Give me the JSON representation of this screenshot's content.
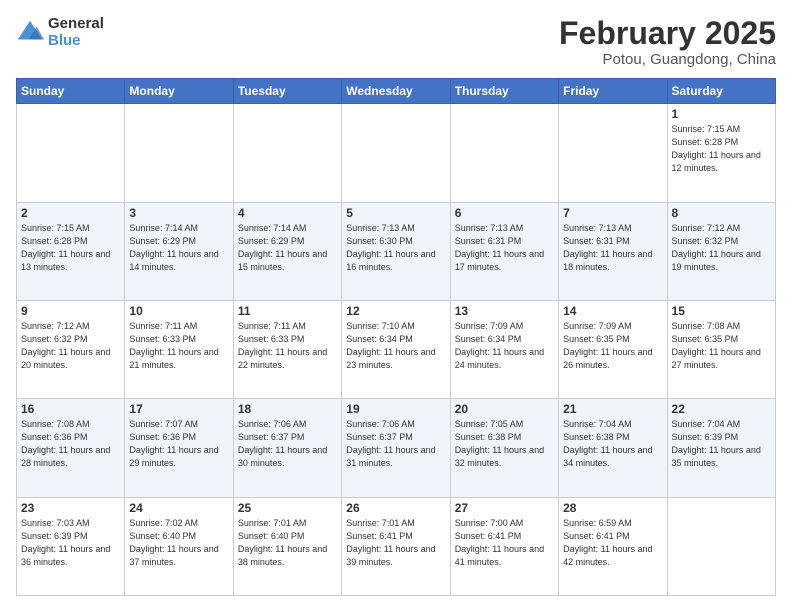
{
  "logo": {
    "line1": "General",
    "line2": "Blue"
  },
  "title": "February 2025",
  "subtitle": "Potou, Guangdong, China",
  "days_header": [
    "Sunday",
    "Monday",
    "Tuesday",
    "Wednesday",
    "Thursday",
    "Friday",
    "Saturday"
  ],
  "weeks": [
    [
      {
        "day": "",
        "info": ""
      },
      {
        "day": "",
        "info": ""
      },
      {
        "day": "",
        "info": ""
      },
      {
        "day": "",
        "info": ""
      },
      {
        "day": "",
        "info": ""
      },
      {
        "day": "",
        "info": ""
      },
      {
        "day": "1",
        "info": "Sunrise: 7:15 AM\nSunset: 6:28 PM\nDaylight: 11 hours and 12 minutes."
      }
    ],
    [
      {
        "day": "2",
        "info": "Sunrise: 7:15 AM\nSunset: 6:28 PM\nDaylight: 11 hours and 13 minutes."
      },
      {
        "day": "3",
        "info": "Sunrise: 7:14 AM\nSunset: 6:29 PM\nDaylight: 11 hours and 14 minutes."
      },
      {
        "day": "4",
        "info": "Sunrise: 7:14 AM\nSunset: 6:29 PM\nDaylight: 11 hours and 15 minutes."
      },
      {
        "day": "5",
        "info": "Sunrise: 7:13 AM\nSunset: 6:30 PM\nDaylight: 11 hours and 16 minutes."
      },
      {
        "day": "6",
        "info": "Sunrise: 7:13 AM\nSunset: 6:31 PM\nDaylight: 11 hours and 17 minutes."
      },
      {
        "day": "7",
        "info": "Sunrise: 7:13 AM\nSunset: 6:31 PM\nDaylight: 11 hours and 18 minutes."
      },
      {
        "day": "8",
        "info": "Sunrise: 7:12 AM\nSunset: 6:32 PM\nDaylight: 11 hours and 19 minutes."
      }
    ],
    [
      {
        "day": "9",
        "info": "Sunrise: 7:12 AM\nSunset: 6:32 PM\nDaylight: 11 hours and 20 minutes."
      },
      {
        "day": "10",
        "info": "Sunrise: 7:11 AM\nSunset: 6:33 PM\nDaylight: 11 hours and 21 minutes."
      },
      {
        "day": "11",
        "info": "Sunrise: 7:11 AM\nSunset: 6:33 PM\nDaylight: 11 hours and 22 minutes."
      },
      {
        "day": "12",
        "info": "Sunrise: 7:10 AM\nSunset: 6:34 PM\nDaylight: 11 hours and 23 minutes."
      },
      {
        "day": "13",
        "info": "Sunrise: 7:09 AM\nSunset: 6:34 PM\nDaylight: 11 hours and 24 minutes."
      },
      {
        "day": "14",
        "info": "Sunrise: 7:09 AM\nSunset: 6:35 PM\nDaylight: 11 hours and 26 minutes."
      },
      {
        "day": "15",
        "info": "Sunrise: 7:08 AM\nSunset: 6:35 PM\nDaylight: 11 hours and 27 minutes."
      }
    ],
    [
      {
        "day": "16",
        "info": "Sunrise: 7:08 AM\nSunset: 6:36 PM\nDaylight: 11 hours and 28 minutes."
      },
      {
        "day": "17",
        "info": "Sunrise: 7:07 AM\nSunset: 6:36 PM\nDaylight: 11 hours and 29 minutes."
      },
      {
        "day": "18",
        "info": "Sunrise: 7:06 AM\nSunset: 6:37 PM\nDaylight: 11 hours and 30 minutes."
      },
      {
        "day": "19",
        "info": "Sunrise: 7:06 AM\nSunset: 6:37 PM\nDaylight: 11 hours and 31 minutes."
      },
      {
        "day": "20",
        "info": "Sunrise: 7:05 AM\nSunset: 6:38 PM\nDaylight: 11 hours and 32 minutes."
      },
      {
        "day": "21",
        "info": "Sunrise: 7:04 AM\nSunset: 6:38 PM\nDaylight: 11 hours and 34 minutes."
      },
      {
        "day": "22",
        "info": "Sunrise: 7:04 AM\nSunset: 6:39 PM\nDaylight: 11 hours and 35 minutes."
      }
    ],
    [
      {
        "day": "23",
        "info": "Sunrise: 7:03 AM\nSunset: 6:39 PM\nDaylight: 11 hours and 36 minutes."
      },
      {
        "day": "24",
        "info": "Sunrise: 7:02 AM\nSunset: 6:40 PM\nDaylight: 11 hours and 37 minutes."
      },
      {
        "day": "25",
        "info": "Sunrise: 7:01 AM\nSunset: 6:40 PM\nDaylight: 11 hours and 38 minutes."
      },
      {
        "day": "26",
        "info": "Sunrise: 7:01 AM\nSunset: 6:41 PM\nDaylight: 11 hours and 39 minutes."
      },
      {
        "day": "27",
        "info": "Sunrise: 7:00 AM\nSunset: 6:41 PM\nDaylight: 11 hours and 41 minutes."
      },
      {
        "day": "28",
        "info": "Sunrise: 6:59 AM\nSunset: 6:41 PM\nDaylight: 11 hours and 42 minutes."
      },
      {
        "day": "",
        "info": ""
      }
    ]
  ]
}
